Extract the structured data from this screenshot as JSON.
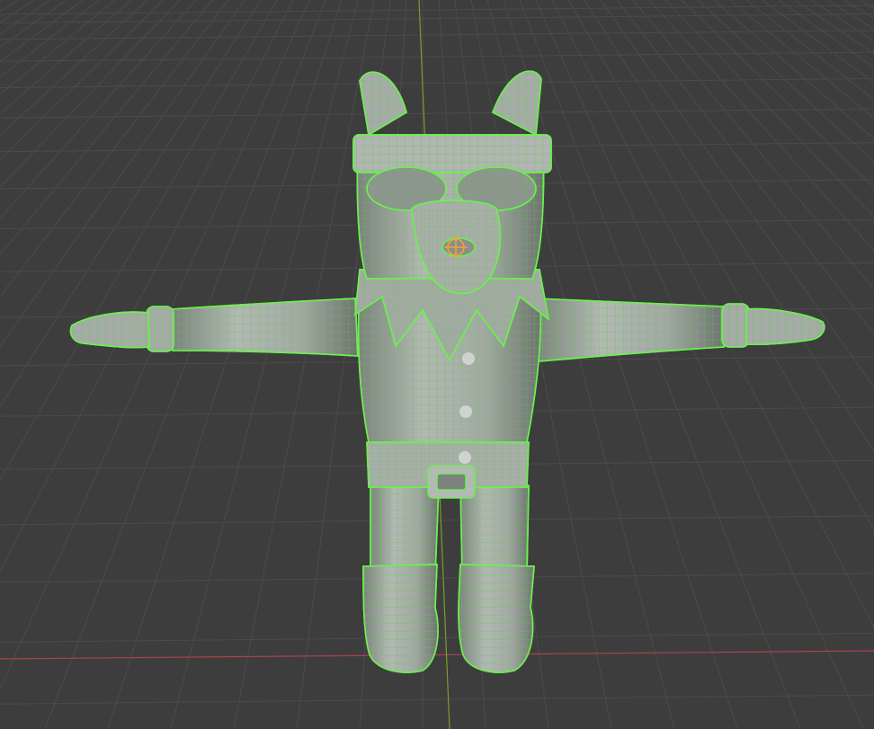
{
  "viewport": {
    "background": "#3d3d3d",
    "grid_color": "#4b4b4b",
    "x_axis_color": "#a8434c",
    "y_axis_color": "#7f9a2b"
  },
  "model": {
    "body_fill": "#9ea39f",
    "shade_fill": "#6f7470",
    "wire_color": "#4fd23c",
    "outline_color": "#6bf04f",
    "button_fill": "#cfd3d0"
  },
  "origin_marker": {
    "icon": "object-origin-icon",
    "color": "#f2a33a"
  }
}
